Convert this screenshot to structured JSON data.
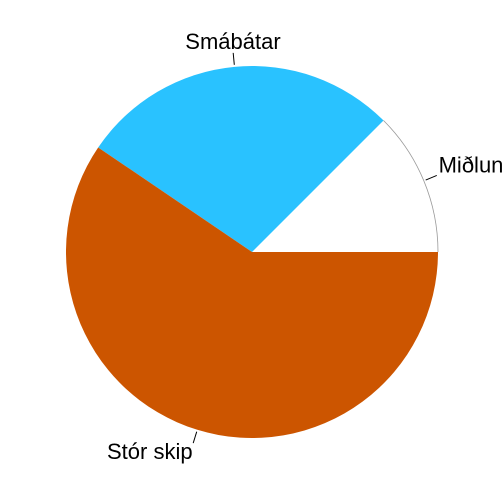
{
  "chart_data": {
    "type": "pie",
    "title": "",
    "start_angle_deg": 0,
    "direction": "counterclockwise",
    "slices": [
      {
        "label": "Miðlungs",
        "value": 12.5,
        "color": "#ffffff"
      },
      {
        "label": "Smábátar",
        "value": 28.0,
        "color": "#29c2ff"
      },
      {
        "label": "Stór skip",
        "value": 59.5,
        "color": "#cc5500"
      }
    ]
  }
}
